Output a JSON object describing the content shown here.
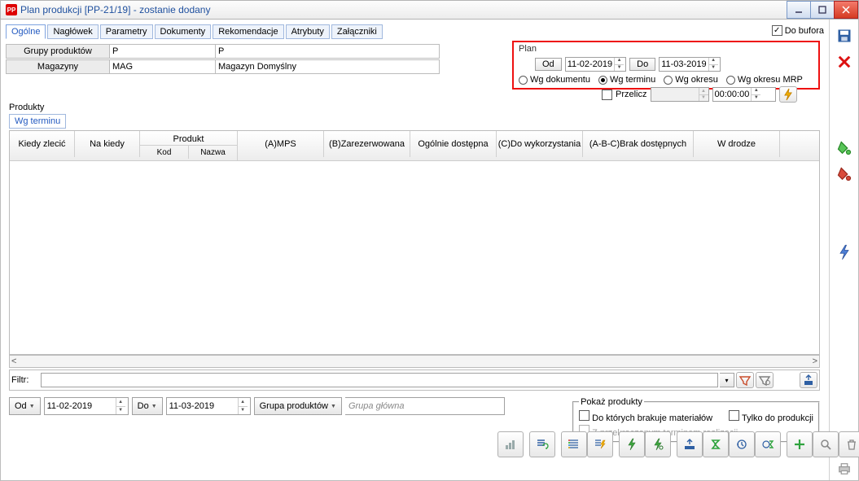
{
  "title": "Plan produkcji [PP-21/19] - zostanie dodany",
  "tabs": [
    "Ogólne",
    "Nagłówek",
    "Parametry",
    "Dokumenty",
    "Rekomendacje",
    "Atrybuty",
    "Załączniki"
  ],
  "activeTab": 0,
  "doBufora": true,
  "header": {
    "grupyLabel": "Grupy produktów",
    "grupy1": "P",
    "grupy2": "P",
    "magazynyLabel": "Magazyny",
    "mag1": "MAG",
    "mag2": "Magazyn Domyślny"
  },
  "plan": {
    "title": "Plan",
    "odBtn": "Od",
    "odDate": "11-02-2019",
    "doBtn": "Do",
    "doDate": "11-03-2019",
    "radios": [
      "Wg dokumentu",
      "Wg terminu",
      "Wg okresu",
      "Wg okresu MRP"
    ],
    "radioSelected": 1
  },
  "przeliczLabel": "Przelicz",
  "timeValue": "00:00:00",
  "produkty": {
    "label": "Produkty",
    "subtab": "Wg terminu",
    "cols": {
      "kiedy": "Kiedy zlecić",
      "nakiedy": "Na kiedy",
      "produkt": "Produkt",
      "kod": "Kod",
      "nazwa": "Nazwa",
      "amps": "(A)MPS",
      "bzar": "(B)Zarezerwowana",
      "odost": "Ogólnie dostępna",
      "cdow": "(C)Do wykorzystania",
      "abc": "(A-B-C)Brak dostępnych",
      "wdrodze": "W drodze"
    }
  },
  "filtrLabel": "Filtr:",
  "bottom": {
    "odBtn": "Od",
    "odDate": "11-02-2019",
    "doBtn": "Do",
    "doDate": "11-03-2019",
    "grupaBtn": "Grupa produktów",
    "grupaPlaceholder": "Grupa główna"
  },
  "pokaz": {
    "legend": "Pokaż produkty",
    "brakuje": "Do których brakuje materiałów",
    "tylko": "Tylko do produkcji",
    "przekroczony": "Z przekroczonym terminem realizacji"
  },
  "doBuforaLabel": "Do bufora"
}
